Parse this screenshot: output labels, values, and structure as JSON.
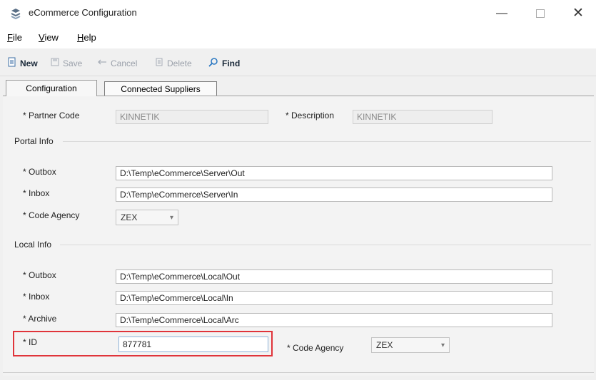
{
  "window": {
    "title": "eCommerce Configuration",
    "controls": {
      "minimize": "—",
      "close": "✕"
    }
  },
  "menu": {
    "file": {
      "underlined": "F",
      "rest": "ile"
    },
    "view": {
      "underlined": "V",
      "rest": "iew"
    },
    "help": {
      "underlined": "H",
      "rest": "elp"
    }
  },
  "toolbar": {
    "new": "New",
    "save": "Save",
    "cancel": "Cancel",
    "delete": "Delete",
    "find": "Find"
  },
  "tabs": [
    "Configuration",
    "Connected Suppliers"
  ],
  "header": {
    "partner_code_label": "* Partner Code",
    "partner_code_value": "KINNETIK",
    "description_label": "* Description",
    "description_value": "KINNETIK"
  },
  "portal": {
    "section": "Portal Info",
    "outbox_label": "* Outbox",
    "outbox_value": "D:\\Temp\\eCommerce\\Server\\Out",
    "inbox_label": "* Inbox",
    "inbox_value": "D:\\Temp\\eCommerce\\Server\\In",
    "code_agency_label": "* Code Agency",
    "code_agency_value": "ZEX"
  },
  "local": {
    "section": "Local Info",
    "outbox_label": "* Outbox",
    "outbox_value": "D:\\Temp\\eCommerce\\Local\\Out",
    "inbox_label": "* Inbox",
    "inbox_value": "D:\\Temp\\eCommerce\\Local\\In",
    "archive_label": "* Archive",
    "archive_value": "D:\\Temp\\eCommerce\\Local\\Arc",
    "id_label": "* ID",
    "id_value": "877781",
    "code_agency_label": "* Code Agency",
    "code_agency_value": "ZEX"
  },
  "colors": {
    "highlight": "#e0343a",
    "background": "#f0f0f0"
  }
}
